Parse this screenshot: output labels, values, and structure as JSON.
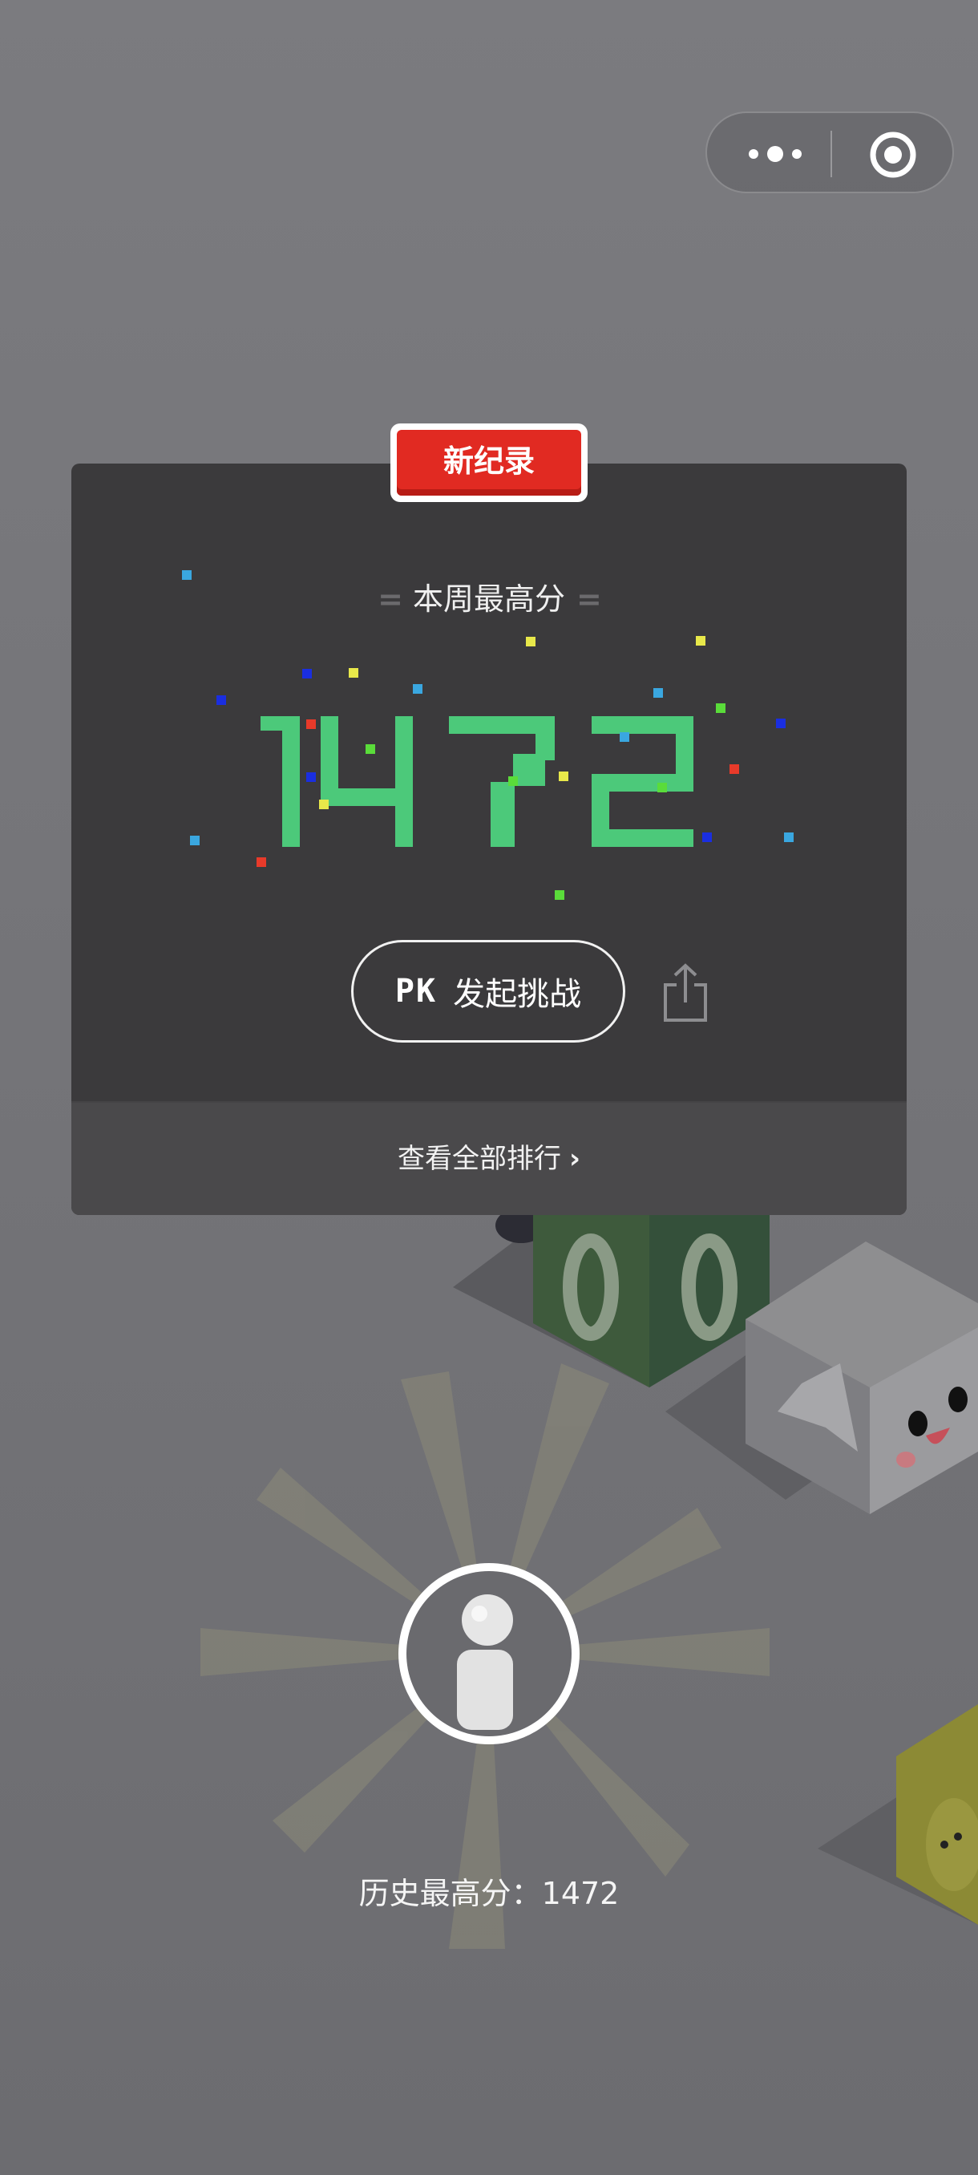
{
  "capsule": {
    "more_icon": "more-dots-icon",
    "close_icon": "target-close-icon"
  },
  "card": {
    "badge": "新纪录",
    "week_label": "本周最高分",
    "week_score": "1472",
    "pk_prefix": "PK",
    "challenge": "发起挑战",
    "share_icon": "share-icon",
    "view_ranking": "查看全部排行",
    "chevron": "›"
  },
  "footer": {
    "history": "历史最高分：1472"
  },
  "colors": {
    "background": "#7a7a7e",
    "card": "#3b3a3c",
    "score": "#4cc97a",
    "badge": "#e12a22"
  }
}
